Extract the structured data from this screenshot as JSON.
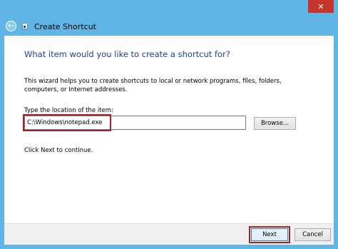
{
  "window": {
    "title": "Create Shortcut",
    "close_glyph": "✕",
    "back_glyph": "←"
  },
  "main": {
    "heading": "What item would you like to create a shortcut for?",
    "description": "This wizard helps you to create shortcuts to local or network programs, files, folders, computers, or Internet addresses.",
    "location_label": "Type the location of the item:",
    "location_value": "C:\\Windows\\notepad.exe",
    "browse_label": "Browse...",
    "hint": "Click Next to continue."
  },
  "footer": {
    "next_label": "Next",
    "cancel_label": "Cancel"
  },
  "colors": {
    "frame": "#5fb5e6",
    "heading": "#1e3f9c",
    "highlight": "#a0232a",
    "close": "#c7342c"
  }
}
